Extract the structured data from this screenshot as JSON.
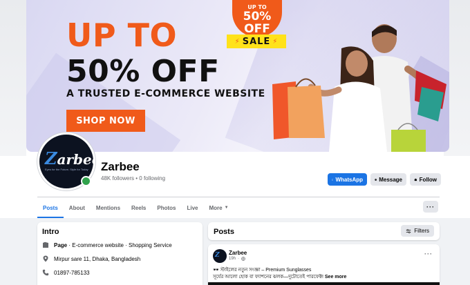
{
  "cover": {
    "headline1": "UP TO",
    "headline2": "50% OFF",
    "tagline": "A TRUSTED E-COMMERCE WEBSITE",
    "cta": "SHOP NOW",
    "badge_upto": "UP TO",
    "badge_pct": "50%",
    "badge_off": "OFF",
    "badge_sale": "SALE"
  },
  "profile": {
    "logo": "arbee",
    "logo_initial": "Z",
    "logo_tagline": "Eyes for the Future, Style for Today",
    "name": "Zarbee",
    "meta": "48K followers • 0 following"
  },
  "actions": {
    "whatsapp": "WhatsApp",
    "message": "Message",
    "follow": "Follow"
  },
  "tabs": [
    {
      "label": "Posts",
      "active": true
    },
    {
      "label": "About"
    },
    {
      "label": "Mentions"
    },
    {
      "label": "Reels"
    },
    {
      "label": "Photos"
    },
    {
      "label": "Live"
    },
    {
      "label": "More"
    }
  ],
  "intro": {
    "title": "Intro",
    "page_label": "Page",
    "page_category": " · E-commerce website · Shopping Service",
    "address": "Mirpur sare 11, Dhaka, Bangladesh",
    "phone": "01897-785133"
  },
  "posts": {
    "title": "Posts",
    "filters_label": "Filters"
  },
  "post": {
    "author": "Zarbee",
    "avatar_initial": "Z",
    "time": "19h",
    "line1": "🕶️ স্টাইলের নতুন সংজ্ঞা – Premium Sunglasses",
    "line2": "সূর্যের আলো হোক বা ফ্যাশনের ঝলক—দুটোতেই পারফেক্ট!",
    "see_more": "See more"
  },
  "colors": {
    "accent": "#1b74e4",
    "cover_orange": "#f05a1a",
    "sale_yellow": "#ffe21a",
    "online": "#31a24c"
  }
}
